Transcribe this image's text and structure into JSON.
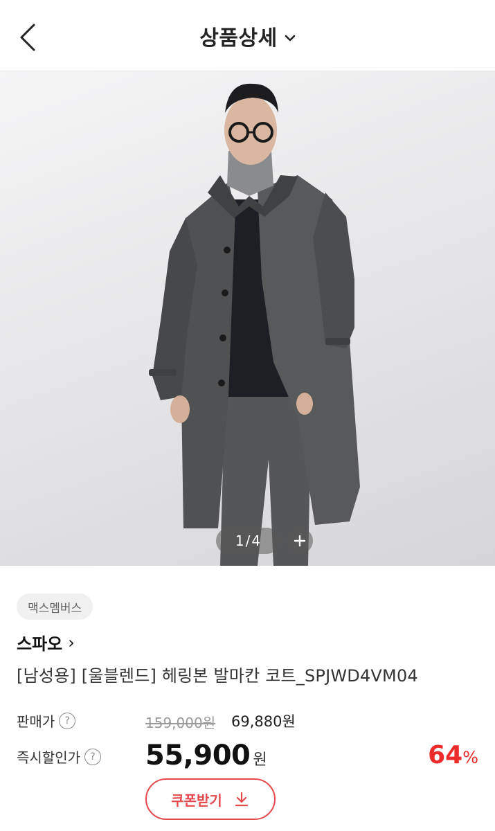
{
  "header": {
    "title": "상품상세",
    "back_icon": "chevron-left-icon",
    "title_caret_icon": "chevron-down-icon"
  },
  "gallery": {
    "current": "1",
    "separator": "/",
    "total": "4",
    "zoom_icon": "plus-icon"
  },
  "product": {
    "badge": "맥스멤버스",
    "brand": "스파오",
    "brand_arrow": "›",
    "name": "[남성용] [울블렌드] 헤링본 발마칸 코트_SPJWD4VM04"
  },
  "pricing": {
    "sale_label": "판매가",
    "original_price": "159,000원",
    "sale_price": "69,880원",
    "instant_label": "즉시할인가",
    "instant_price": "55,900",
    "instant_unit": "원",
    "discount_value": "64",
    "discount_unit": "%",
    "help_icon": "question-mark-icon"
  },
  "coupon": {
    "label": "쿠폰받기",
    "icon": "download-icon"
  },
  "colors": {
    "accent": "#e5484d",
    "discount": "#ee2b2b"
  }
}
